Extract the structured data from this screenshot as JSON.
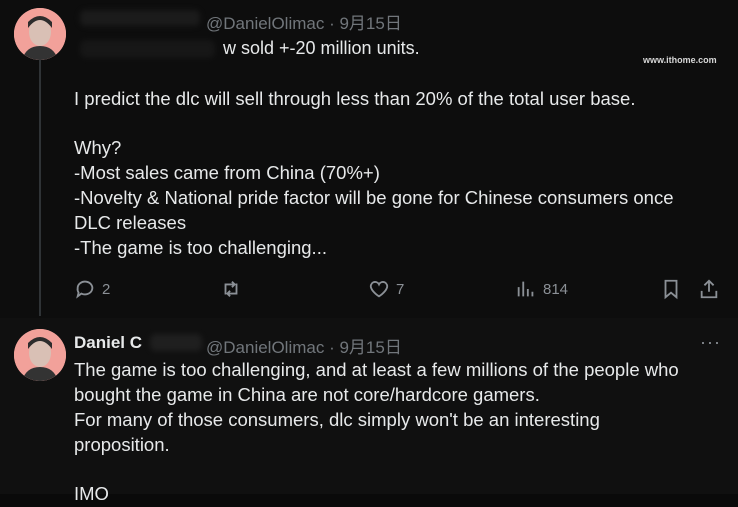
{
  "post1": {
    "handle_line": "@DanielOlimac · 9月15日",
    "lines": [
      "w sold +-20 million units.",
      "I predict the dlc will sell through less than 20% of the total user base.",
      "Why?",
      "-Most sales came from China (70%+)",
      "-Novelty & National pride factor will be gone for Chinese consumers once",
      "DLC releases",
      "-The game is too challenging..."
    ],
    "actions": {
      "replies": "2",
      "likes": "7",
      "views": "814"
    }
  },
  "post2": {
    "name": "Daniel C",
    "handle_line": "@DanielOlimac · 9月15日",
    "lines": [
      "The game is too challenging, and at least a few millions of the people who",
      "bought the game in China are not core/hardcore gamers.",
      "For many of those consumers, dlc simply won't be an interesting",
      "proposition.",
      "IMO"
    ],
    "more_label": "···"
  },
  "watermark": "www.ithome.com",
  "icons": [
    "reply-icon",
    "repost-icon",
    "like-icon",
    "views-icon",
    "bookmark-icon",
    "share-icon",
    "more-icon"
  ]
}
